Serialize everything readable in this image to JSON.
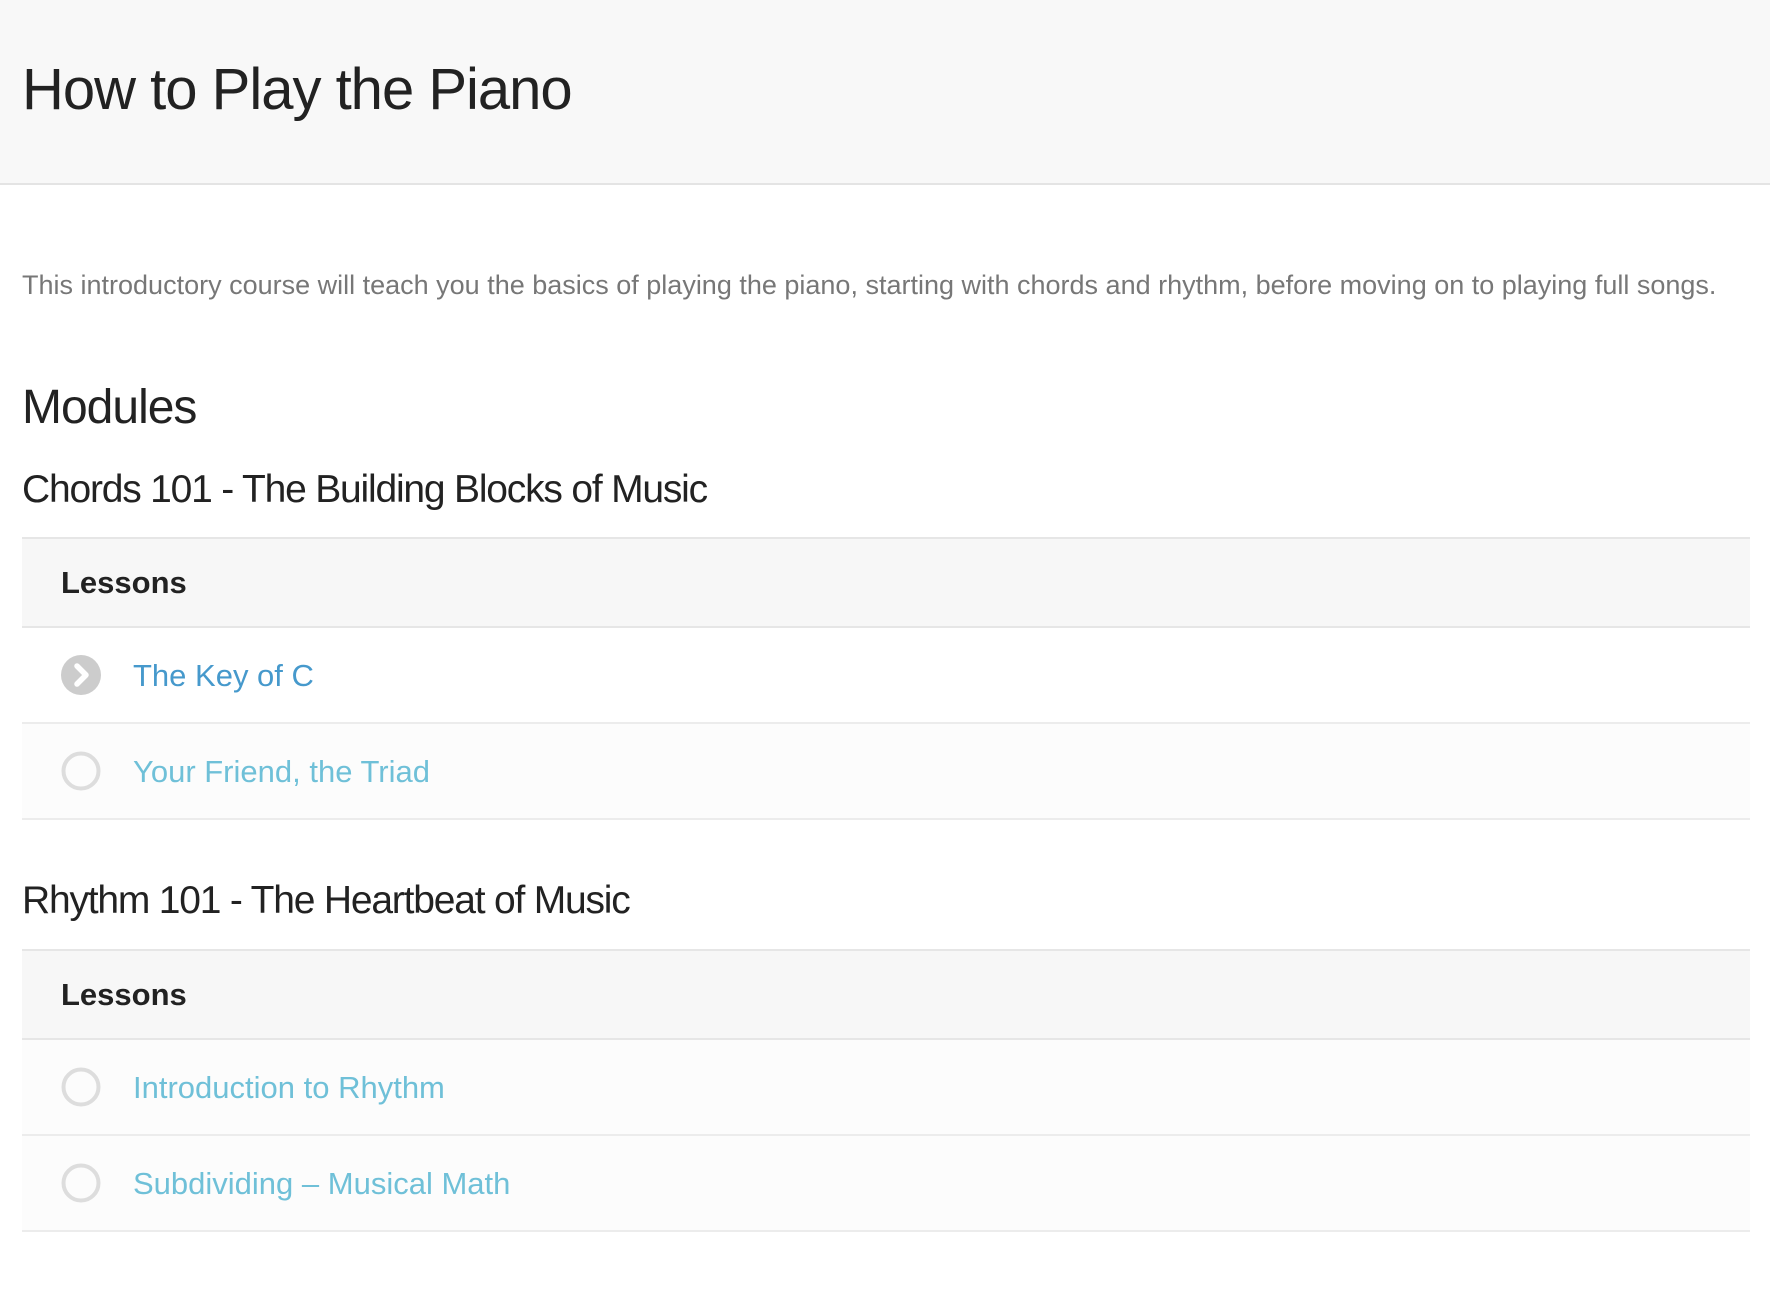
{
  "header": {
    "title": "How to Play the Piano"
  },
  "course": {
    "description": "This introductory course will teach you the basics of playing the piano, starting with chords and rhythm, before moving on to playing full songs."
  },
  "modules_section": {
    "heading": "Modules"
  },
  "modules": [
    {
      "title": "Chords 101 - The Building Blocks of Music",
      "lessons_header": "Lessons",
      "lessons": [
        {
          "title": "The Key of C",
          "status": "current",
          "status_icon": "chevron-circle-icon"
        },
        {
          "title": "Your Friend, the Triad",
          "status": "not-started",
          "status_icon": "empty-circle-icon"
        }
      ]
    },
    {
      "title": "Rhythm 101 - The Heartbeat of Music",
      "lessons_header": "Lessons",
      "lessons": [
        {
          "title": "Introduction to Rhythm",
          "status": "not-started",
          "status_icon": "empty-circle-icon"
        },
        {
          "title": "Subdividing – Musical Math",
          "status": "not-started",
          "status_icon": "empty-circle-icon"
        }
      ]
    }
  ],
  "colors": {
    "header_background": "#f8f8f8",
    "link_current": "#4699cc",
    "link_default": "#6fc0d8",
    "icon_gray": "#cccccc"
  }
}
